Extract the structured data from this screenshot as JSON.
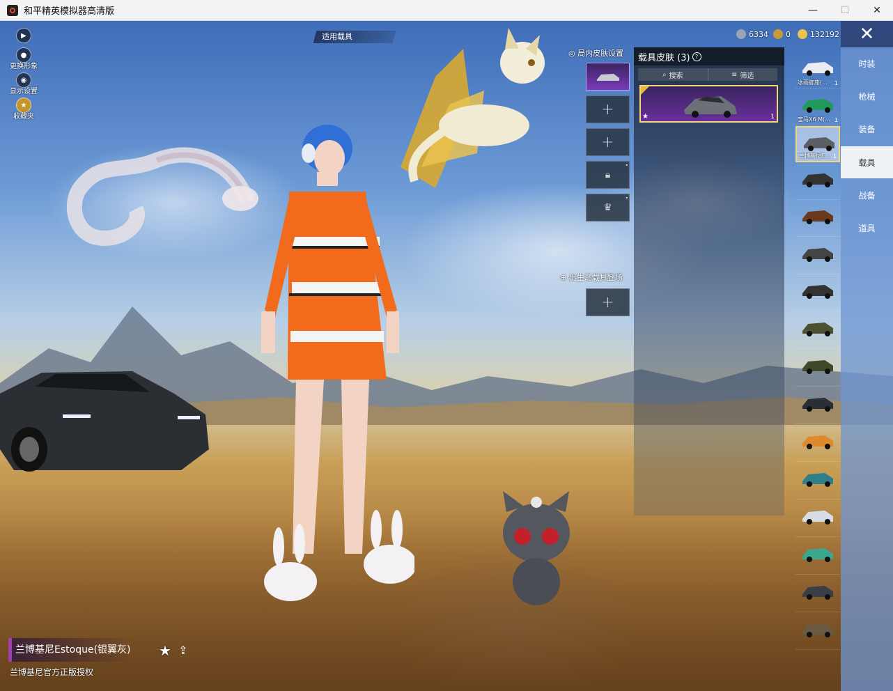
{
  "window": {
    "title": "和平精英模拟器高清版",
    "controls": {
      "minimize": "—",
      "maximize": "☐",
      "close": "✕"
    }
  },
  "left_controls": [
    {
      "label": "更换形象",
      "icon": "person-icon"
    },
    {
      "label": "显示设置",
      "icon": "eye-icon"
    },
    {
      "label": "收藏夹",
      "icon": "badge-icon"
    }
  ],
  "top_badge": "适用载具",
  "currency": [
    {
      "value": "6334",
      "color": "#9aa6b8"
    },
    {
      "value": "0",
      "color": "#c89a3a"
    },
    {
      "value": "132192",
      "color": "#e8c24a"
    }
  ],
  "skin_settings": {
    "title": "局内皮肤设置",
    "spawn_label": "出生岛载具登场",
    "add_symbol": "+"
  },
  "panel": {
    "title": "载具皮肤 (3)",
    "help": "?",
    "search": "搜索",
    "filter": "筛选",
    "card_count": "1"
  },
  "vehicles": [
    {
      "name": "冰雨御座(...",
      "count": "1",
      "color": "#e9edf2"
    },
    {
      "name": "宝马X6 M(...",
      "count": "1",
      "color": "#1f9a5a"
    },
    {
      "name": "兰博基尼E...",
      "count": "1",
      "color": "#5a5f66"
    },
    {
      "name": "",
      "count": "",
      "color": "#333"
    },
    {
      "name": "",
      "count": "",
      "color": "#6b3a1e"
    },
    {
      "name": "",
      "count": "",
      "color": "#444"
    },
    {
      "name": "",
      "count": "",
      "color": "#333"
    },
    {
      "name": "",
      "count": "",
      "color": "#4c5230"
    },
    {
      "name": "",
      "count": "",
      "color": "#3f4a2a"
    },
    {
      "name": "",
      "count": "",
      "color": "#2a2f36"
    },
    {
      "name": "",
      "count": "",
      "color": "#e0892b"
    },
    {
      "name": "",
      "count": "",
      "color": "#2f7f8a"
    },
    {
      "name": "",
      "count": "",
      "color": "#d7dde5"
    },
    {
      "name": "",
      "count": "",
      "color": "#3aa88f"
    },
    {
      "name": "",
      "count": "",
      "color": "#3a3f46"
    },
    {
      "name": "",
      "count": "",
      "color": "#6a5a44"
    }
  ],
  "categories": [
    "时装",
    "枪械",
    "装备",
    "载具",
    "战备",
    "道具"
  ],
  "active_category": "载具",
  "selected_vehicle": {
    "name": "兰博基尼Estoque(银翼灰)",
    "license": "兰博基尼官方正版授权"
  }
}
